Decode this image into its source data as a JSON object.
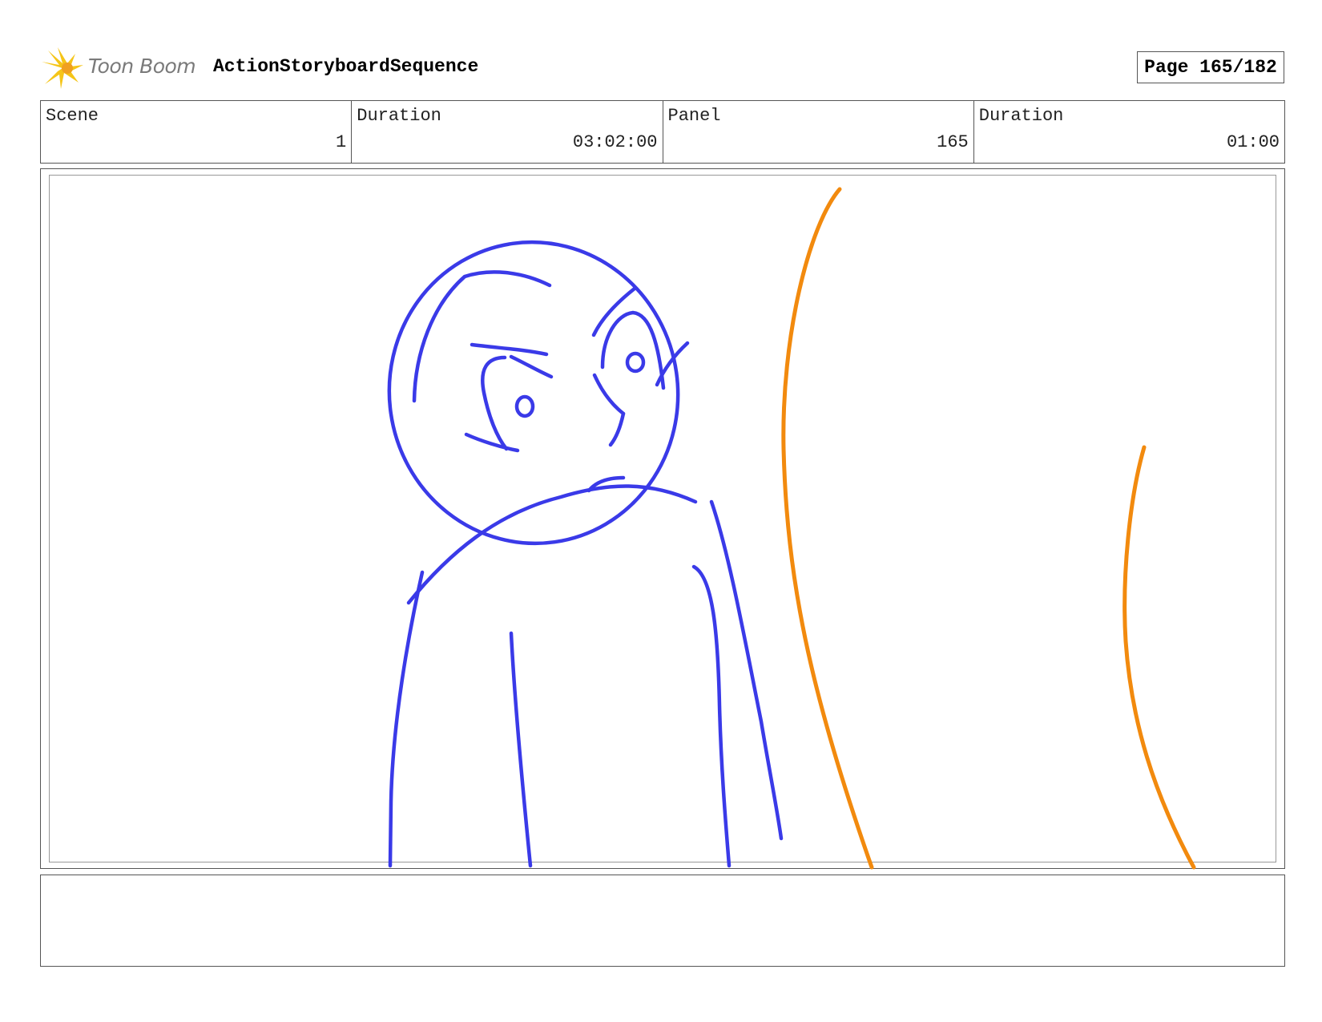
{
  "header": {
    "logo_text": "Toon Boom",
    "title": "ActionStoryboardSequence",
    "page_label": "Page 165/182"
  },
  "info": {
    "scene_label": "Scene",
    "scene_value": "1",
    "scene_duration_label": "Duration",
    "scene_duration_value": "03:02:00",
    "panel_label": "Panel",
    "panel_value": "165",
    "panel_duration_label": "Duration",
    "panel_duration_value": "01:00"
  },
  "sketch": {
    "character_color": "#3a3ae8",
    "background_color": "#f28a0e"
  },
  "notes": {
    "text": ""
  },
  "icons": {
    "logo": "toon-boom-star-logo-icon"
  }
}
